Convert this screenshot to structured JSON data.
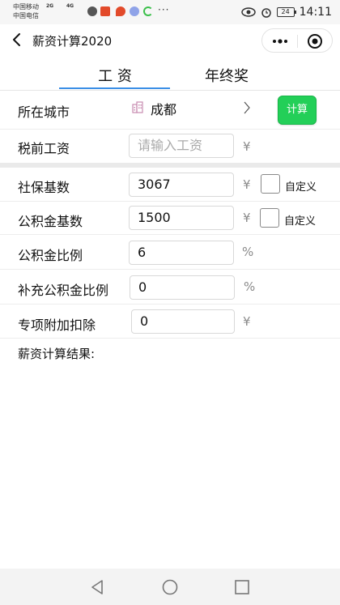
{
  "status_bar": {
    "carrier1": "中国移动",
    "carrier2": "中国电信",
    "signal1": "2G",
    "signal2": "4G",
    "dots": "···",
    "battery": "24",
    "time": "14:11"
  },
  "nav": {
    "title": "薪资计算2020"
  },
  "tabs": [
    {
      "label": "工 资",
      "active": true
    },
    {
      "label": "年终奖",
      "active": false
    }
  ],
  "form": {
    "city": {
      "label": "所在城市",
      "value": "成都"
    },
    "calc_button": "计算",
    "pretax": {
      "label": "税前工资",
      "placeholder": "请输入工资",
      "unit": "¥"
    },
    "social_base": {
      "label": "社保基数",
      "value": "3067",
      "unit": "¥",
      "custom_label": "自定义"
    },
    "fund_base": {
      "label": "公积金基数",
      "value": "1500",
      "unit": "¥",
      "custom_label": "自定义"
    },
    "fund_ratio": {
      "label": "公积金比例",
      "value": "6",
      "unit": "%"
    },
    "supp_fund_ratio": {
      "label": "补充公积金比例",
      "value": "0",
      "unit": "%"
    },
    "special_deduction": {
      "label": "专项附加扣除",
      "value": "0",
      "unit": "¥"
    }
  },
  "result": {
    "label": "薪资计算结果:"
  },
  "colors": {
    "accent": "#3a8ee6",
    "button_green": "#23cf58"
  }
}
